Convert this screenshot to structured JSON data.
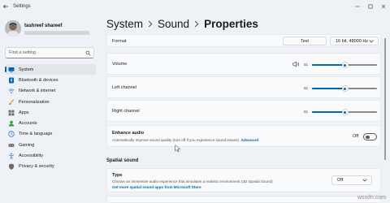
{
  "window": {
    "title": "Settings",
    "controls": [
      "minimize-icon",
      "maximize-icon",
      "close-icon"
    ]
  },
  "user": {
    "name": "tashreef shareef"
  },
  "search": {
    "placeholder": "Find a setting"
  },
  "nav": {
    "items": [
      {
        "label": "System",
        "icon": "monitor-icon",
        "active": true,
        "color": "#0067c0"
      },
      {
        "label": "Bluetooth & devices",
        "icon": "bluetooth-icon",
        "active": false,
        "color": "#0067c0"
      },
      {
        "label": "Network & internet",
        "icon": "wifi-icon",
        "active": false,
        "color": "#2b7cd3"
      },
      {
        "label": "Personalization",
        "icon": "brush-icon",
        "active": false,
        "color": "#e8912b"
      },
      {
        "label": "Apps",
        "icon": "apps-icon",
        "active": false,
        "color": "#6b6b6b"
      },
      {
        "label": "Accounts",
        "icon": "person-icon",
        "active": false,
        "color": "#2ea043"
      },
      {
        "label": "Time & language",
        "icon": "globe-clock-icon",
        "active": false,
        "color": "#2b7cd3"
      },
      {
        "label": "Gaming",
        "icon": "gamepad-icon",
        "active": false,
        "color": "#6b6b6b"
      },
      {
        "label": "Accessibility",
        "icon": "accessibility-icon",
        "active": false,
        "color": "#2b7cd3"
      },
      {
        "label": "Privacy & security",
        "icon": "shield-icon",
        "active": false,
        "color": "#6b6b6b"
      }
    ]
  },
  "breadcrumb": {
    "items": [
      "System",
      "Sound"
    ],
    "current": "Properties"
  },
  "format": {
    "label": "Format",
    "test_button": "Test",
    "selected": "16 bit, 48000 Hz"
  },
  "volume": {
    "label": "Volume",
    "value": "51",
    "level": 0.51
  },
  "left_channel": {
    "label": "Left channel",
    "value": "51",
    "level": 0.51
  },
  "right_channel": {
    "label": "Right channel",
    "value": "51",
    "level": 0.51
  },
  "enhance_audio": {
    "label": "Enhance audio",
    "description": "Automatically improve sound quality (turn off if you experience sound issues).",
    "link": "Advanced",
    "state_label": "Off",
    "on": false
  },
  "spatial_sound": {
    "section_title": "Spatial sound",
    "type_label": "Type",
    "type_description": "Choose an immersive audio experience that simulates a realistic environment (3D Spatial Sound)",
    "store_link": "Get more spatial sound apps from Microsoft Store",
    "selected": "Off"
  },
  "watermark": "wsxdn.com",
  "colors": {
    "accent": "#0067c0",
    "background": "#eef1f5",
    "card": "#f9fafb"
  }
}
